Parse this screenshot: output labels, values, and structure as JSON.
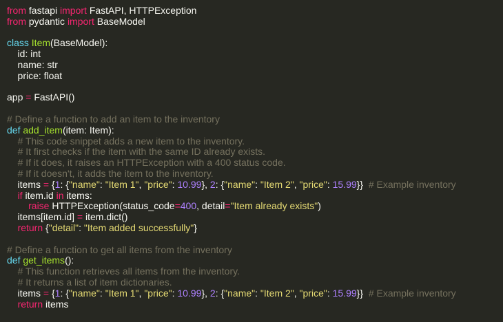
{
  "colors": {
    "background": "#272822",
    "plain": "#f8f8f2",
    "keyword": "#f92672",
    "def": "#66d9ef",
    "function": "#a6e22e",
    "string": "#e6db74",
    "number": "#ae81ff",
    "comment": "#75715e"
  },
  "code_lines": [
    [
      [
        "keyword",
        "from"
      ],
      [
        "plain",
        " fastapi "
      ],
      [
        "keyword",
        "import"
      ],
      [
        "plain",
        " FastAPI, HTTPException"
      ]
    ],
    [
      [
        "keyword",
        "from"
      ],
      [
        "plain",
        " pydantic "
      ],
      [
        "keyword",
        "import"
      ],
      [
        "plain",
        " BaseModel"
      ]
    ],
    [],
    [
      [
        "def",
        "class"
      ],
      [
        "plain",
        " "
      ],
      [
        "fn",
        "Item"
      ],
      [
        "plain",
        "(BaseModel):"
      ]
    ],
    [
      [
        "plain",
        "    id: int"
      ]
    ],
    [
      [
        "plain",
        "    name: str"
      ]
    ],
    [
      [
        "plain",
        "    price: float"
      ]
    ],
    [],
    [
      [
        "plain",
        "app "
      ],
      [
        "keyword",
        "="
      ],
      [
        "plain",
        " FastAPI()"
      ]
    ],
    [],
    [
      [
        "comment",
        "# Define a function to add an item to the inventory"
      ]
    ],
    [
      [
        "def",
        "def"
      ],
      [
        "plain",
        " "
      ],
      [
        "fn",
        "add_item"
      ],
      [
        "plain",
        "(item: Item):"
      ]
    ],
    [
      [
        "plain",
        "    "
      ],
      [
        "comment",
        "# This code snippet adds a new item to the inventory."
      ]
    ],
    [
      [
        "plain",
        "    "
      ],
      [
        "comment",
        "# It first checks if the item with the same ID already exists."
      ]
    ],
    [
      [
        "plain",
        "    "
      ],
      [
        "comment",
        "# If it does, it raises an HTTPException with a 400 status code."
      ]
    ],
    [
      [
        "plain",
        "    "
      ],
      [
        "comment",
        "# If it doesn't, it adds the item to the inventory."
      ]
    ],
    [
      [
        "plain",
        "    items "
      ],
      [
        "keyword",
        "="
      ],
      [
        "plain",
        " {"
      ],
      [
        "number",
        "1"
      ],
      [
        "plain",
        ": {"
      ],
      [
        "string",
        "\"name\""
      ],
      [
        "plain",
        ": "
      ],
      [
        "string",
        "\"Item 1\""
      ],
      [
        "plain",
        ", "
      ],
      [
        "string",
        "\"price\""
      ],
      [
        "plain",
        ": "
      ],
      [
        "number",
        "10.99"
      ],
      [
        "plain",
        "}, "
      ],
      [
        "number",
        "2"
      ],
      [
        "plain",
        ": {"
      ],
      [
        "string",
        "\"name\""
      ],
      [
        "plain",
        ": "
      ],
      [
        "string",
        "\"Item 2\""
      ],
      [
        "plain",
        ", "
      ],
      [
        "string",
        "\"price\""
      ],
      [
        "plain",
        ": "
      ],
      [
        "number",
        "15.99"
      ],
      [
        "plain",
        "}}  "
      ],
      [
        "comment",
        "# Example inventory"
      ]
    ],
    [
      [
        "plain",
        "    "
      ],
      [
        "keyword",
        "if"
      ],
      [
        "plain",
        " item.id "
      ],
      [
        "keyword",
        "in"
      ],
      [
        "plain",
        " items:"
      ]
    ],
    [
      [
        "plain",
        "        "
      ],
      [
        "keyword",
        "raise"
      ],
      [
        "plain",
        " HTTPException(status_code"
      ],
      [
        "keyword",
        "="
      ],
      [
        "number",
        "400"
      ],
      [
        "plain",
        ", detail"
      ],
      [
        "keyword",
        "="
      ],
      [
        "string",
        "\"Item already exists\""
      ],
      [
        "plain",
        ")"
      ]
    ],
    [
      [
        "plain",
        "    items[item.id] "
      ],
      [
        "keyword",
        "="
      ],
      [
        "plain",
        " item.dict()"
      ]
    ],
    [
      [
        "plain",
        "    "
      ],
      [
        "keyword",
        "return"
      ],
      [
        "plain",
        " {"
      ],
      [
        "string",
        "\"detail\""
      ],
      [
        "plain",
        ": "
      ],
      [
        "string",
        "\"Item added successfully\""
      ],
      [
        "plain",
        "}"
      ]
    ],
    [],
    [
      [
        "comment",
        "# Define a function to get all items from the inventory"
      ]
    ],
    [
      [
        "def",
        "def"
      ],
      [
        "plain",
        " "
      ],
      [
        "fn",
        "get_items"
      ],
      [
        "plain",
        "():"
      ]
    ],
    [
      [
        "plain",
        "    "
      ],
      [
        "comment",
        "# This function retrieves all items from the inventory."
      ]
    ],
    [
      [
        "plain",
        "    "
      ],
      [
        "comment",
        "# It returns a list of item dictionaries."
      ]
    ],
    [
      [
        "plain",
        "    items "
      ],
      [
        "keyword",
        "="
      ],
      [
        "plain",
        " {"
      ],
      [
        "number",
        "1"
      ],
      [
        "plain",
        ": {"
      ],
      [
        "string",
        "\"name\""
      ],
      [
        "plain",
        ": "
      ],
      [
        "string",
        "\"Item 1\""
      ],
      [
        "plain",
        ", "
      ],
      [
        "string",
        "\"price\""
      ],
      [
        "plain",
        ": "
      ],
      [
        "number",
        "10.99"
      ],
      [
        "plain",
        "}, "
      ],
      [
        "number",
        "2"
      ],
      [
        "plain",
        ": {"
      ],
      [
        "string",
        "\"name\""
      ],
      [
        "plain",
        ": "
      ],
      [
        "string",
        "\"Item 2\""
      ],
      [
        "plain",
        ", "
      ],
      [
        "string",
        "\"price\""
      ],
      [
        "plain",
        ": "
      ],
      [
        "number",
        "15.99"
      ],
      [
        "plain",
        "}}  "
      ],
      [
        "comment",
        "# Example inventory"
      ]
    ],
    [
      [
        "plain",
        "    "
      ],
      [
        "keyword",
        "return"
      ],
      [
        "plain",
        " items"
      ]
    ]
  ]
}
